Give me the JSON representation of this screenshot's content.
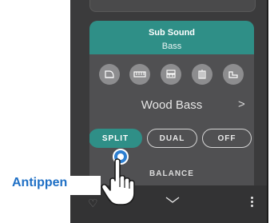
{
  "panel": {
    "header_title": "Sub Sound",
    "header_subtitle": "Bass"
  },
  "instrument_icons": [
    "grand-piano-icon",
    "electric-piano-icon",
    "organ-icon",
    "strings-icon",
    "harpsichord-icon",
    "more-instruments-icon"
  ],
  "sound": {
    "name": "Wood Bass",
    "next_glyph": ">"
  },
  "modes": {
    "split": "SPLIT",
    "dual": "DUAL",
    "off": "OFF",
    "selected": "SPLIT"
  },
  "balance_label": "BALANCE",
  "annotation": {
    "tap_label": "Antippen"
  },
  "colors": {
    "accent": "#2f8f87",
    "panel": "#3b3b3c",
    "card": "#505052",
    "tap_label": "#1e6fc5",
    "tap_indicator": "#2d7fd1"
  }
}
